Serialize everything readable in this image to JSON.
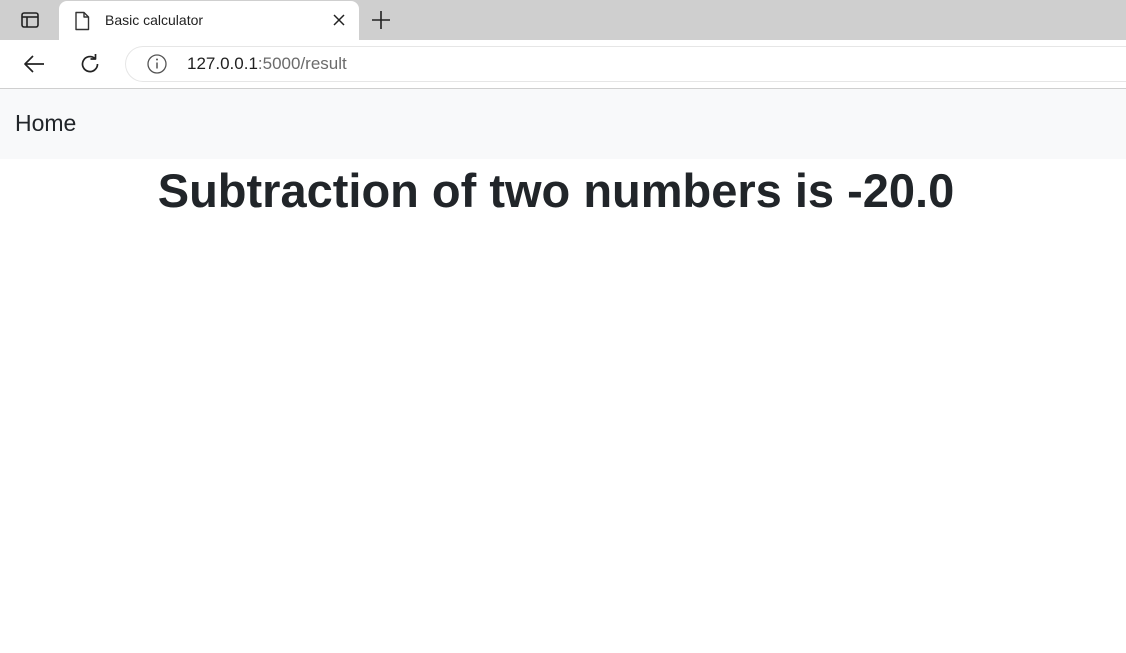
{
  "browser": {
    "tab": {
      "title": "Basic calculator",
      "favicon": "page-icon"
    },
    "address_bar": {
      "host": "127.0.0.1",
      "rest": ":5000/result",
      "security_icon": "info-icon"
    },
    "icons": {
      "sidebar": "sidebar-icon",
      "close": "close-icon",
      "new_tab": "plus-icon",
      "back": "back-arrow-icon",
      "reload": "reload-icon"
    }
  },
  "page": {
    "navbar": {
      "home_label": "Home",
      "background": "#f8f9fa"
    },
    "heading": "Subtraction of two numbers is -20.0",
    "text_color": "#212529"
  }
}
